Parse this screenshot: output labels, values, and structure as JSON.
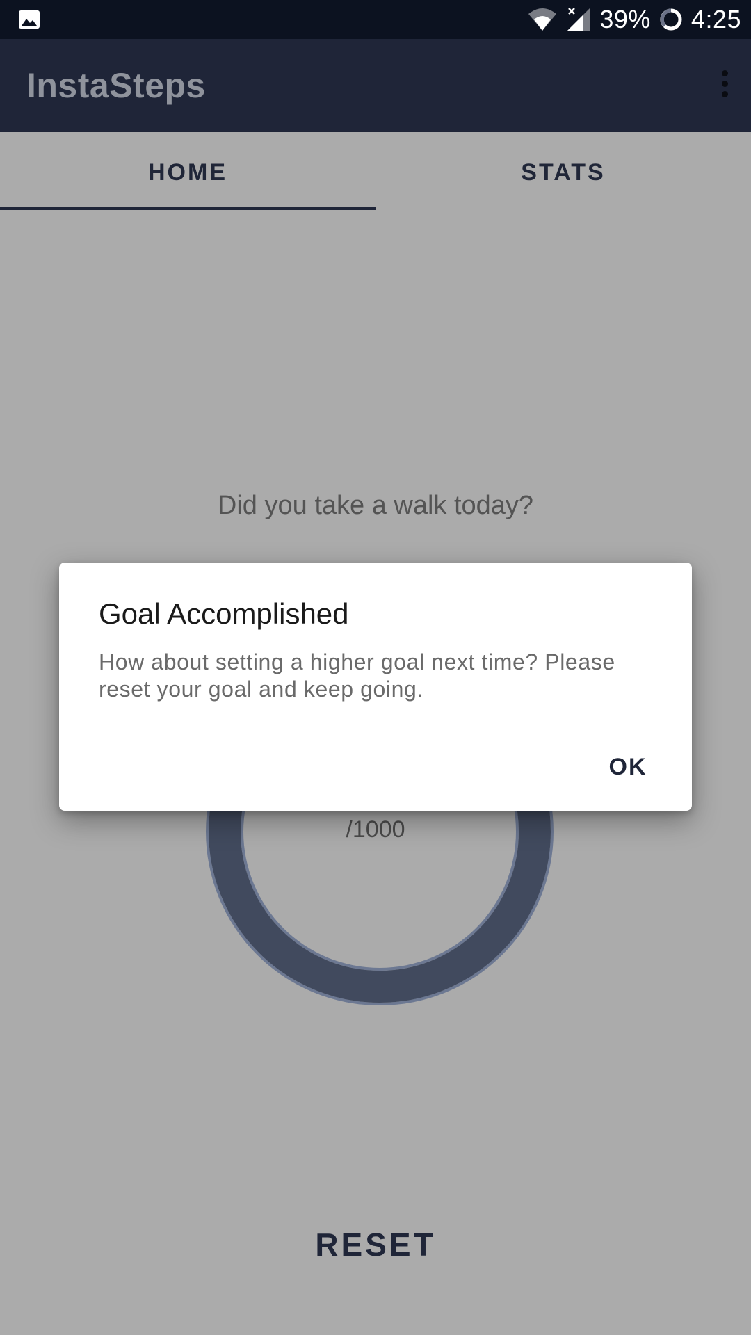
{
  "status_bar": {
    "notification_icon": "image-icon",
    "wifi_icon": "wifi-icon",
    "signal_icon": "signal-no-sim-icon",
    "battery_percent": "39%",
    "battery_icon": "battery-ring-icon",
    "time": "4:25"
  },
  "app_bar": {
    "title": "InstaSteps",
    "menu_icon": "more-vert-icon"
  },
  "tabs": [
    {
      "label": "HOME",
      "selected": true
    },
    {
      "label": "STATS",
      "selected": false
    }
  ],
  "main": {
    "prompt": "Did you take a walk today?",
    "goal_text": "/1000",
    "reset_label": "RESET"
  },
  "dialog": {
    "title": "Goal Accomplished",
    "message": "How about setting a higher goal next time? Please reset your goal and keep going.",
    "ok_label": "OK"
  },
  "colors": {
    "status_bar": "#0c1220",
    "app_bar": "#1f2538",
    "accent": "#1f2538",
    "scrim_background": "#ababab",
    "ring": "#414a5e"
  }
}
